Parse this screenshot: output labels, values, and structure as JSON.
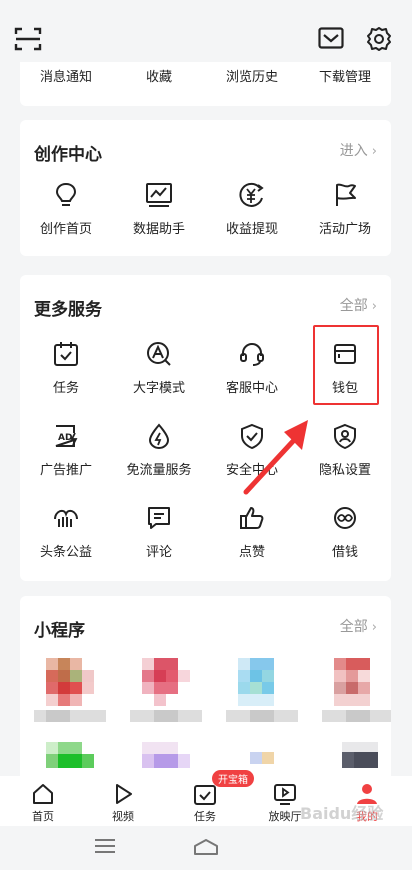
{
  "top_shortcuts": [
    "消息通知",
    "收藏",
    "浏览历史",
    "下载管理"
  ],
  "creation_center": {
    "title": "创作中心",
    "more": "进入",
    "items": [
      "创作首页",
      "数据助手",
      "收益提现",
      "活动广场"
    ]
  },
  "more_services": {
    "title": "更多服务",
    "more": "全部",
    "items": [
      "任务",
      "大字模式",
      "客服中心",
      "钱包",
      "广告推广",
      "免流量服务",
      "安全中心",
      "隐私设置",
      "头条公益",
      "评论",
      "点赞",
      "借钱"
    ]
  },
  "mini_programs": {
    "title": "小程序",
    "more": "全部"
  },
  "bottom_nav": {
    "items": [
      "首页",
      "视频",
      "任务",
      "放映厅",
      "我的"
    ],
    "task_badge": "开宝箱"
  },
  "watermark": "Baidu经验",
  "colors": {
    "accent": "#f04142",
    "highlight": "#e33333"
  }
}
